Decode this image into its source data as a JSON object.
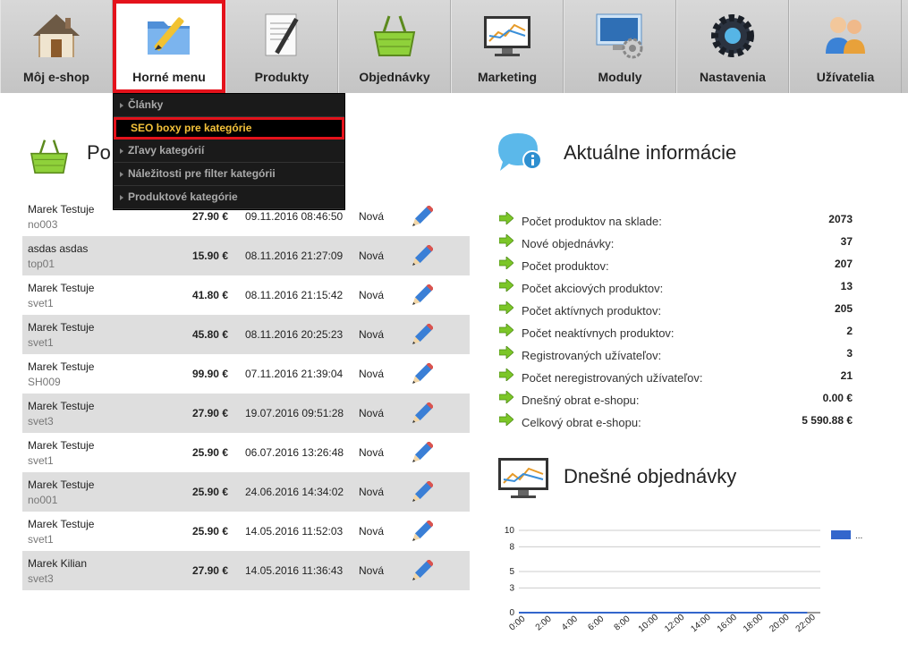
{
  "nav": [
    {
      "label": "Môj e-shop",
      "icon": "house-icon"
    },
    {
      "label": "Horné menu",
      "icon": "folder-pencil-icon"
    },
    {
      "label": "Produkty",
      "icon": "document-pen-icon"
    },
    {
      "label": "Objednávky",
      "icon": "basket-icon"
    },
    {
      "label": "Marketing",
      "icon": "monitor-chart-icon"
    },
    {
      "label": "Moduly",
      "icon": "computer-gear-icon"
    },
    {
      "label": "Nastavenia",
      "icon": "gears-icon"
    },
    {
      "label": "Užívatelia",
      "icon": "users-icon"
    }
  ],
  "dropdown": [
    {
      "label": "Články"
    },
    {
      "label": "SEO boxy pre kategórie"
    },
    {
      "label": "Zľavy kategórií"
    },
    {
      "label": "Náležitosti pre filter kategórii"
    },
    {
      "label": "Produktové kategórie"
    }
  ],
  "left": {
    "title": "Po",
    "icon": "basket-icon"
  },
  "orders": [
    {
      "name": "Marek Testuje",
      "code": "no003",
      "price": "27.90 €",
      "date": "09.11.2016 08:46:50",
      "status": "Nová"
    },
    {
      "name": "asdas asdas",
      "code": "top01",
      "price": "15.90 €",
      "date": "08.11.2016 21:27:09",
      "status": "Nová"
    },
    {
      "name": "Marek Testuje",
      "code": "svet1",
      "price": "41.80 €",
      "date": "08.11.2016 21:15:42",
      "status": "Nová"
    },
    {
      "name": "Marek Testuje",
      "code": "svet1",
      "price": "45.80 €",
      "date": "08.11.2016 20:25:23",
      "status": "Nová"
    },
    {
      "name": "Marek Testuje",
      "code": "SH009",
      "price": "99.90 €",
      "date": "07.11.2016 21:39:04",
      "status": "Nová"
    },
    {
      "name": "Marek Testuje",
      "code": "svet3",
      "price": "27.90 €",
      "date": "19.07.2016 09:51:28",
      "status": "Nová"
    },
    {
      "name": "Marek Testuje",
      "code": "svet1",
      "price": "25.90 €",
      "date": "06.07.2016 13:26:48",
      "status": "Nová"
    },
    {
      "name": "Marek Testuje",
      "code": "no001",
      "price": "25.90 €",
      "date": "24.06.2016 14:34:02",
      "status": "Nová"
    },
    {
      "name": "Marek Testuje",
      "code": "svet1",
      "price": "25.90 €",
      "date": "14.05.2016 11:52:03",
      "status": "Nová"
    },
    {
      "name": "Marek Kilian",
      "code": "svet3",
      "price": "27.90 €",
      "date": "14.05.2016 11:36:43",
      "status": "Nová"
    }
  ],
  "info": {
    "title": "Aktuálne informácie",
    "icon": "info-bubble-icon",
    "stats": [
      {
        "label": "Počet produktov na sklade:",
        "value": "2073"
      },
      {
        "label": "Nové objednávky:",
        "value": "37"
      },
      {
        "label": "Počet produktov:",
        "value": "207"
      },
      {
        "label": "Počet akciových produktov:",
        "value": "13"
      },
      {
        "label": "Počet aktívnych produktov:",
        "value": "205"
      },
      {
        "label": "Počet neaktívnych produktov:",
        "value": "2"
      },
      {
        "label": "Registrovaných užívateľov:",
        "value": "3"
      },
      {
        "label": "Počet neregistrovaných užívateľov:",
        "value": "21"
      },
      {
        "label": "Dnešný obrat e-shopu:",
        "value": "0.00 €"
      },
      {
        "label": "Celkový obrat e-shopu:",
        "value": "5 590.88 €"
      }
    ]
  },
  "today": {
    "title": "Dnešné objednávky",
    "icon": "monitor-chart-icon"
  },
  "chart_data": {
    "type": "line",
    "x": [
      "0:00",
      "2:00",
      "4:00",
      "6:00",
      "8:00",
      "10:00",
      "12:00",
      "14:00",
      "16:00",
      "18:00",
      "20:00",
      "22:00"
    ],
    "yticks": [
      0,
      3,
      5,
      8,
      10
    ],
    "ylim": [
      0,
      10
    ],
    "series": [
      {
        "name": "...",
        "color": "#3366cc",
        "values": [
          0,
          0,
          0,
          0,
          0,
          0,
          0,
          0,
          0,
          0,
          0,
          0
        ]
      }
    ],
    "legend": "right"
  },
  "colors": {
    "accent": "#e4121b",
    "dropdown_active": "#f3c13a",
    "arrow": "#7cc628"
  }
}
